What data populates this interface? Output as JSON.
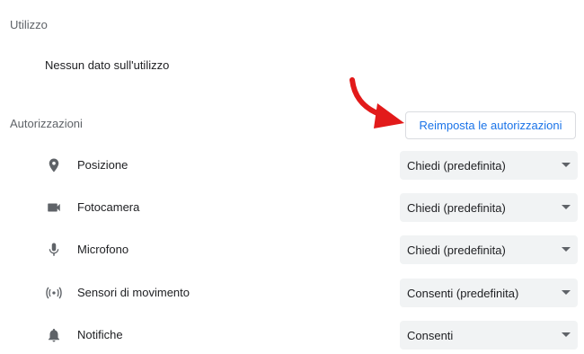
{
  "usage": {
    "title": "Utilizzo",
    "text": "Nessun dato sull'utilizzo"
  },
  "permissions": {
    "title": "Autorizzazioni",
    "reset_label": "Reimposta le autorizzazioni",
    "items": [
      {
        "icon": "location-pin-icon",
        "label": "Posizione",
        "value": "Chiedi (predefinita)"
      },
      {
        "icon": "camera-icon",
        "label": "Fotocamera",
        "value": "Chiedi (predefinita)"
      },
      {
        "icon": "microphone-icon",
        "label": "Microfono",
        "value": "Chiedi (predefinita)"
      },
      {
        "icon": "motion-sensor-icon",
        "label": "Sensori di movimento",
        "value": "Consenti (predefinita)"
      },
      {
        "icon": "bell-icon",
        "label": "Notifiche",
        "value": "Consenti"
      }
    ]
  },
  "colors": {
    "accent": "#1a73e8",
    "annotation_arrow": "#e21a1a",
    "select_bg": "#f1f3f4"
  }
}
